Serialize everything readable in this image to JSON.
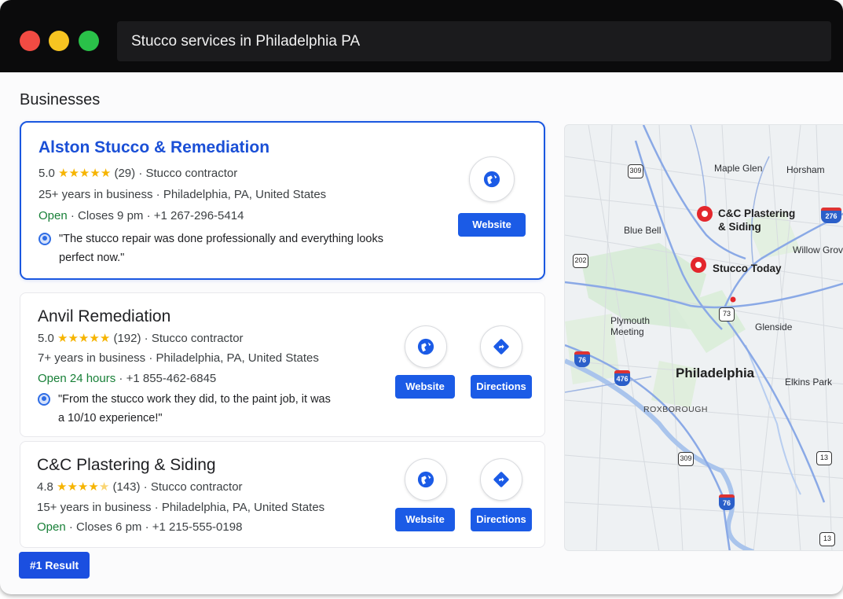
{
  "search": {
    "query": "Stucco services in Philadelphia PA"
  },
  "section_title": "Businesses",
  "colors": {
    "accent": "#1b5be6",
    "open": "#188038",
    "star": "#f6b400"
  },
  "businesses": [
    {
      "name": "Alston Stucco & Remediation",
      "rating": "5.0",
      "stars": "★★★★★",
      "reviews": "(29)",
      "category": "· Stucco contractor",
      "years": "25+ years in business · Philadelphia, PA, United States",
      "status": "Open",
      "hours_phone": "· Closes 9 pm · +1 267-296-5414",
      "review": "\"The stucco repair was done professionally and everything looks perfect now.\"",
      "website_label": "Website"
    },
    {
      "name": "Anvil Remediation",
      "rating": "5.0",
      "stars": "★★★★★",
      "reviews": "(192)",
      "category": "· Stucco contractor",
      "years": "7+ years in business · Philadelphia, PA, United States",
      "status": "Open 24 hours",
      "hours_phone": "· +1 855-462-6845",
      "review": "\"From the stucco work they did, to the paint job, it was a 10/10 experience!\"",
      "website_label": "Website",
      "directions_label": "Directions"
    },
    {
      "name": "C&C Plastering & Siding",
      "rating": "4.8",
      "stars": "★★★★",
      "half_star": "★",
      "reviews": "(143)",
      "category": "· Stucco contractor",
      "years": "15+ years in business · Philadelphia, PA, United States",
      "status": "Open",
      "hours_phone": "· Closes 6 pm · +1 215-555-0198",
      "website_label": "Website",
      "directions_label": "Directions"
    }
  ],
  "result_badge": "#1 Result",
  "map": {
    "labels": {
      "maple_glen": "Maple Glen",
      "horsham": "Horsham",
      "blue_bell": "Blue Bell",
      "willow_grove": "Willow Grove",
      "plymouth_meeting": "Plymouth Meeting",
      "glenside": "Glenside",
      "philadelphia": "Philadelphia",
      "elkins_park": "Elkins Park",
      "roxborough": "ROXBOROUGH"
    },
    "pins": [
      {
        "name": "C&C Plastering & Siding"
      },
      {
        "name": "Stucco Today"
      }
    ],
    "shields": [
      "309",
      "276",
      "202",
      "73",
      "76",
      "476",
      "309",
      "13",
      "76",
      "13"
    ]
  }
}
